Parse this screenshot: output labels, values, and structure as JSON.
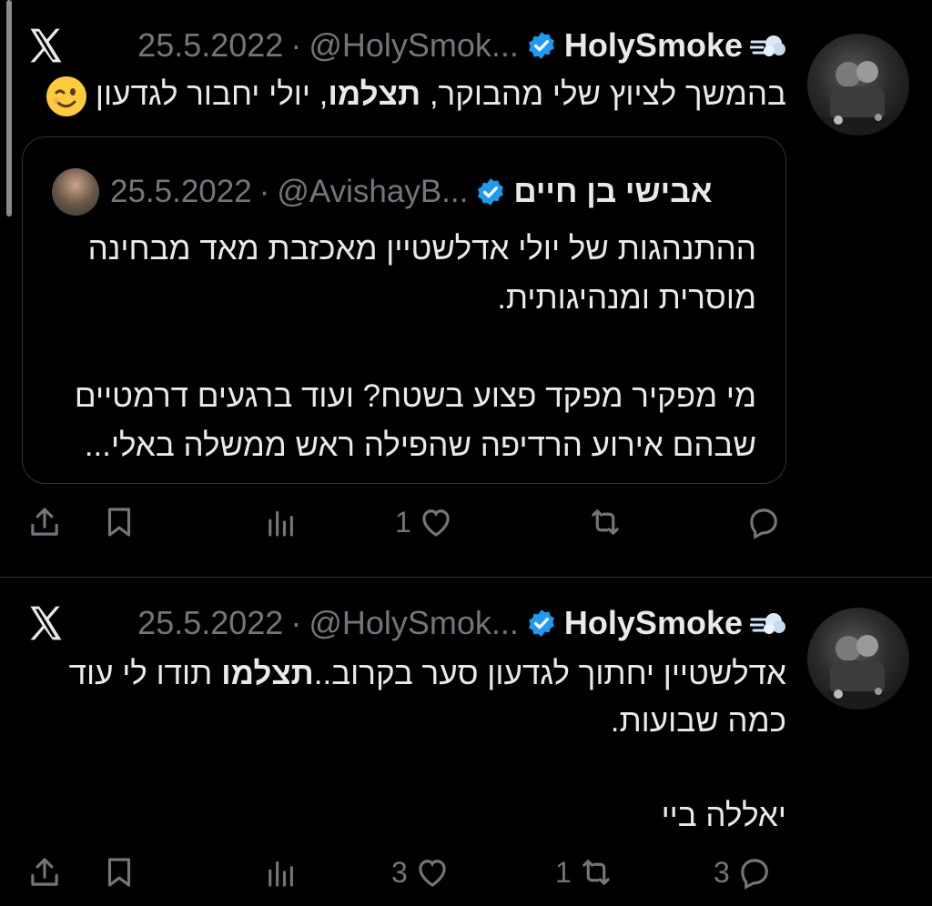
{
  "tweets": [
    {
      "display_name": "HolySmoke",
      "handle": "@HolySmok...",
      "date": "25.5.2022",
      "separator": "·",
      "text_part1": "בהמשך לציוץ שלי מהבוקר, ",
      "text_bold": "תצלמו",
      "text_part2": ", יולי יחבור לגדעון ",
      "quote": {
        "display_name": "אבישי בן חיים",
        "handle": "@AvishayB...",
        "date": "25.5.2022",
        "separator": "·",
        "paragraph1": "ההתנהגות של יולי אדלשטיין מאכזבת מאד מבחינה מוסרית ומנהיגותית.",
        "paragraph2": "מי מפקיר מפקד פצוע בשטח? ועוד ברגעים דרמטיים שבהם אירוע הרדיפה שהפילה ראש ממשלה באלי..."
      },
      "actions": {
        "replies": "",
        "retweets": "",
        "likes": "1",
        "views": ""
      }
    },
    {
      "display_name": "HolySmoke",
      "handle": "@HolySmok...",
      "date": "25.5.2022",
      "separator": "·",
      "line1_part1": "אדלשטיין יחתוך לגדעון סער בקרוב..",
      "line1_bold": "תצלמו",
      "line1_part2": " תודו לי עוד כמה שבועות.",
      "line2": "יאללה ביי",
      "actions": {
        "replies": "3",
        "retweets": "1",
        "likes": "3",
        "views": ""
      }
    }
  ],
  "colors": {
    "background": "#000000",
    "text": "#e7e9ea",
    "muted": "#71767b",
    "verified": "#1d9bf0",
    "border": "#2f3336"
  },
  "icons": [
    "x-logo-icon",
    "verified-badge-icon",
    "dash-emoji-icon",
    "wink-emoji-icon",
    "reply-icon",
    "retweet-icon",
    "like-icon",
    "views-icon",
    "bookmark-icon",
    "share-icon"
  ]
}
